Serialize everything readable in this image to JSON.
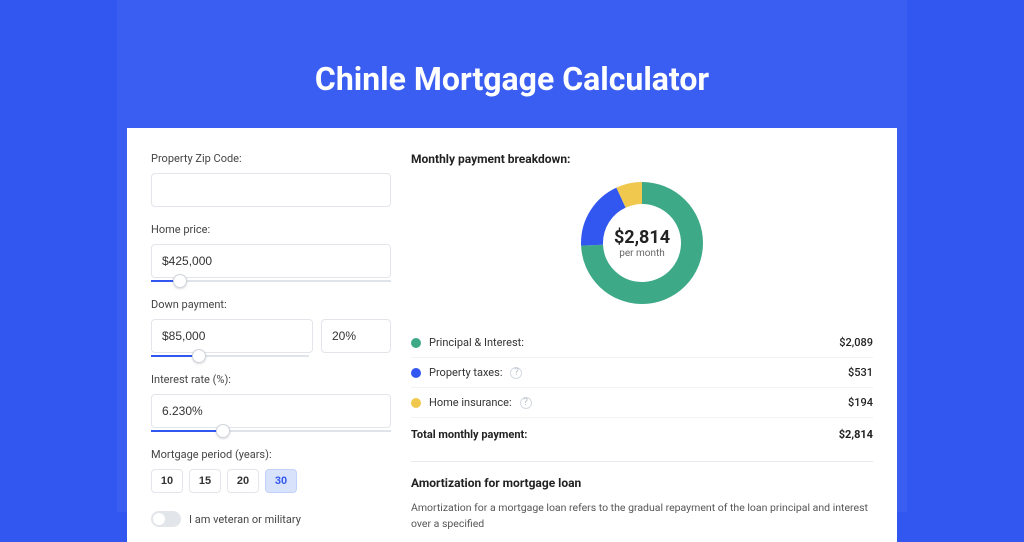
{
  "page": {
    "title": "Chinle Mortgage Calculator"
  },
  "form": {
    "zip": {
      "label": "Property Zip Code:",
      "value": ""
    },
    "home_price": {
      "label": "Home price:",
      "value": "$425,000",
      "slider_pct": 12
    },
    "down_payment": {
      "label": "Down payment:",
      "value": "$85,000",
      "pct_value": "20%",
      "slider_pct": 20
    },
    "interest_rate": {
      "label": "Interest rate (%):",
      "value": "6.230%",
      "slider_pct": 30
    },
    "period": {
      "label": "Mortgage period (years):",
      "options": [
        "10",
        "15",
        "20",
        "30"
      ],
      "selected": "30"
    },
    "veteran": {
      "label": "I am veteran or military",
      "checked": false
    }
  },
  "breakdown": {
    "title": "Monthly payment breakdown:",
    "donut": {
      "value": "$2,814",
      "sub": "per month"
    },
    "items": [
      {
        "label": "Principal & Interest:",
        "value": "$2,089",
        "color": "green",
        "info": false
      },
      {
        "label": "Property taxes:",
        "value": "$531",
        "color": "blue",
        "info": true
      },
      {
        "label": "Home insurance:",
        "value": "$194",
        "color": "yellow",
        "info": true
      }
    ],
    "total": {
      "label": "Total monthly payment:",
      "value": "$2,814"
    }
  },
  "chart_data": {
    "type": "pie",
    "title": "Monthly payment breakdown:",
    "series": [
      {
        "name": "Principal & Interest",
        "value": 2089,
        "color": "#3ea987"
      },
      {
        "name": "Property taxes",
        "value": 531,
        "color": "#3257f0"
      },
      {
        "name": "Home insurance",
        "value": 194,
        "color": "#f0c84d"
      }
    ],
    "total": 2814,
    "center_label": "$2,814 per month"
  },
  "amortization": {
    "title": "Amortization for mortgage loan",
    "text": "Amortization for a mortgage loan refers to the gradual repayment of the loan principal and interest over a specified"
  }
}
